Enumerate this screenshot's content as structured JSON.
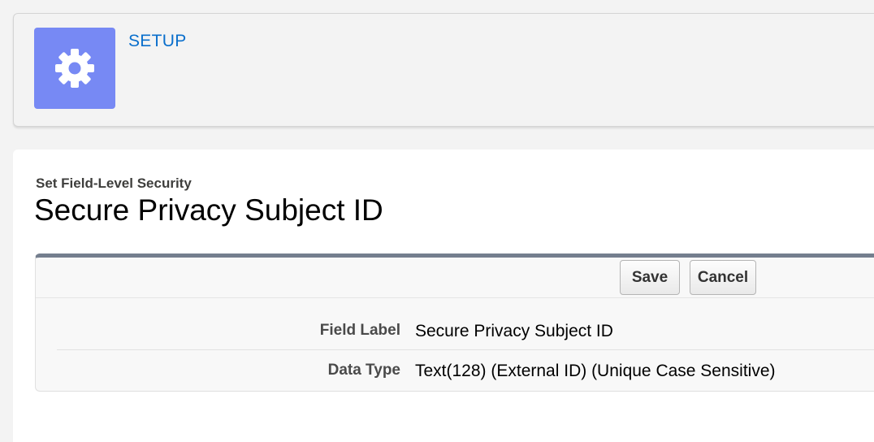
{
  "header": {
    "title": "SETUP",
    "icon": "gear-icon",
    "icon_bg_color": "#7789f4",
    "title_color": "#0a6fcc"
  },
  "page": {
    "subtitle": "Set Field-Level Security",
    "title": "Secure Privacy Subject ID"
  },
  "buttons": {
    "save_label": "Save",
    "cancel_label": "Cancel"
  },
  "fields": [
    {
      "label": "Field Label",
      "value": "Secure Privacy Subject ID"
    },
    {
      "label": "Data Type",
      "value": "Text(128) (External ID) (Unique Case Sensitive)"
    }
  ]
}
